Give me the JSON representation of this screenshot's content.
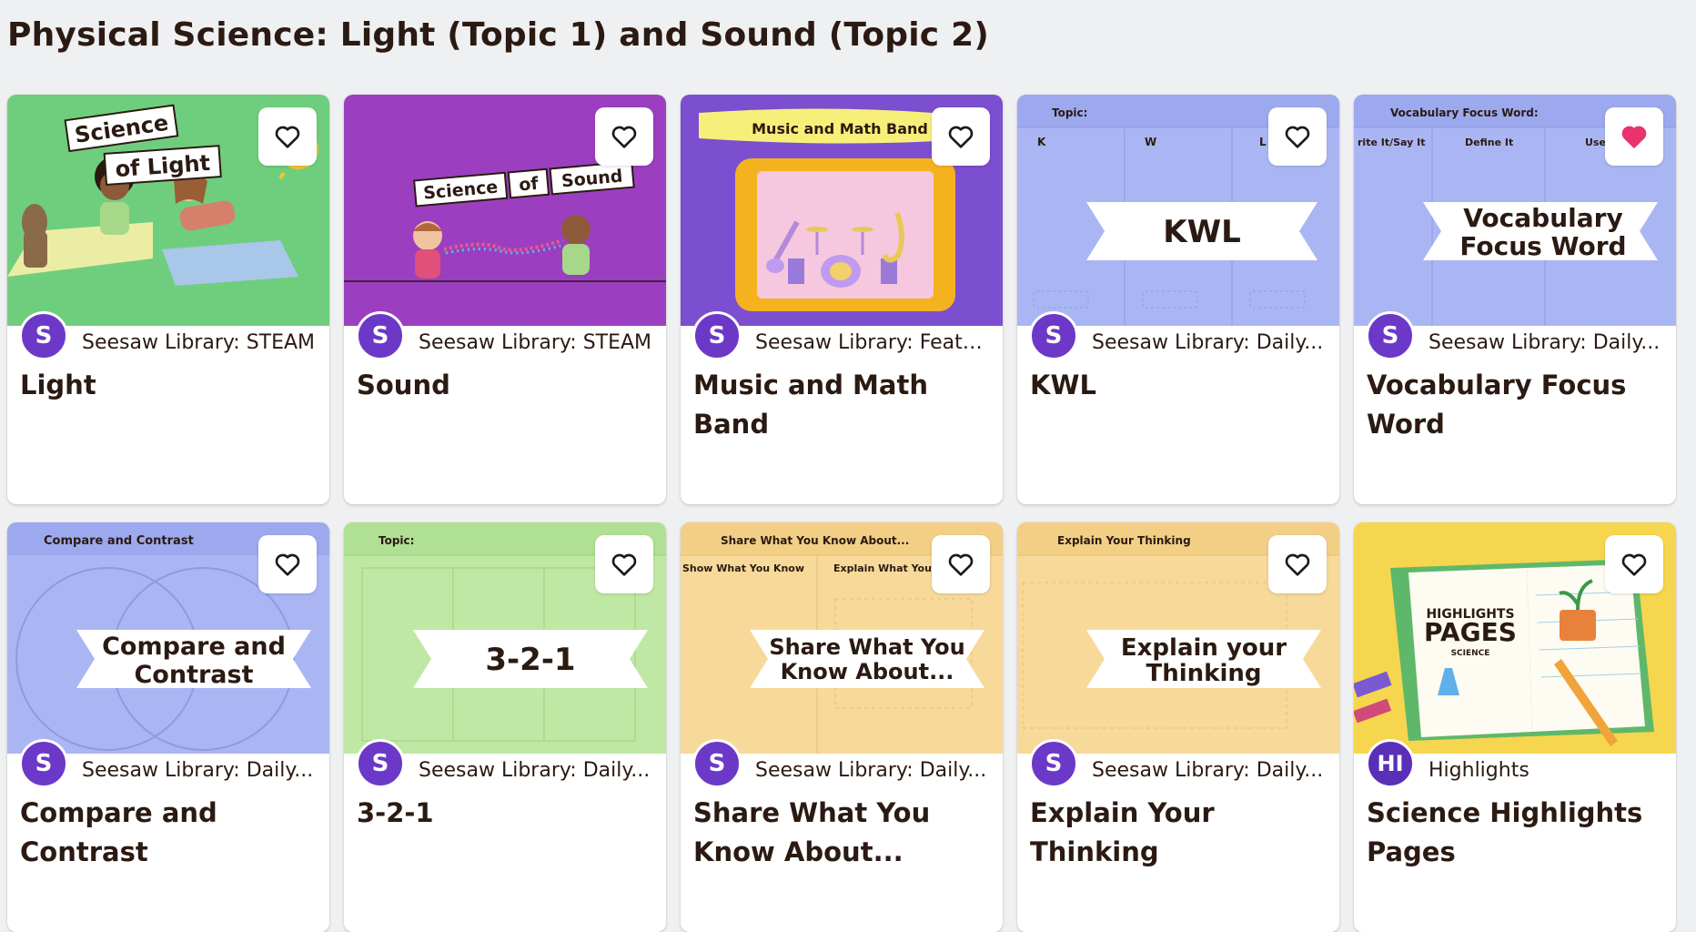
{
  "page_title": "Physical Science: Light (Topic 1) and Sound (Topic 2)",
  "colors": {
    "accent_purple": "#6c38c8",
    "favorite_active": "#e8336d",
    "text": "#2b1a12",
    "page_bg": "#eff0f2"
  },
  "cards": [
    {
      "title": "Light",
      "source": "Seesaw Library: STEAM",
      "avatar": "S",
      "favorited": false,
      "thumb": {
        "text_1": "Science",
        "text_2": "of Light"
      }
    },
    {
      "title": "Sound",
      "source": "Seesaw Library: STEAM",
      "avatar": "S",
      "favorited": false,
      "thumb": {
        "text_1": "Science",
        "text_2": "of",
        "text_3": "Sound"
      }
    },
    {
      "title": "Music and Math Band",
      "source": "Seesaw Library: Feature...",
      "avatar": "S",
      "favorited": false,
      "thumb": {
        "text_1": "Music and Math Band"
      }
    },
    {
      "title": "KWL",
      "source": "Seesaw Library: Daily...",
      "avatar": "S",
      "favorited": false,
      "thumb": {
        "header": "Topic:",
        "text_1": "KWL",
        "cols": [
          "K",
          "W",
          "L"
        ]
      }
    },
    {
      "title": "Vocabulary Focus Word",
      "source": "Seesaw Library: Daily...",
      "avatar": "S",
      "favorited": true,
      "thumb": {
        "header": "Vocabulary Focus Word:",
        "text_1": "Vocabulary",
        "text_2": "Focus Word",
        "cols": [
          "rite It/Say It",
          "Define It",
          "Use"
        ]
      }
    },
    {
      "title": "Compare and Contrast",
      "source": "Seesaw Library: Daily...",
      "avatar": "S",
      "favorited": false,
      "thumb": {
        "header": "Compare and Contrast",
        "text_1": "Compare and",
        "text_2": "Contrast"
      }
    },
    {
      "title": "3-2-1",
      "source": "Seesaw Library: Daily...",
      "avatar": "S",
      "favorited": false,
      "thumb": {
        "header": "Topic:",
        "text_1": "3-2-1"
      }
    },
    {
      "title": "Share What You Know About...",
      "source": "Seesaw Library: Daily...",
      "avatar": "S",
      "favorited": false,
      "thumb": {
        "header": "Share What You Know About...",
        "text_1": "Share What You",
        "text_2": "Know About...",
        "cols": [
          "Show What You Know",
          "Explain What You K"
        ]
      }
    },
    {
      "title": "Explain Your Thinking",
      "source": "Seesaw Library: Daily...",
      "avatar": "S",
      "favorited": false,
      "thumb": {
        "header": "Explain Your Thinking",
        "text_1": "Explain your",
        "text_2": "Thinking"
      }
    },
    {
      "title": "Science Highlights Pages",
      "source": "Highlights",
      "avatar": "HI",
      "favorited": false,
      "thumb": {
        "text_1": "HIGHLIGHTS",
        "text_2": "PAGES",
        "text_3": "SCIENCE"
      }
    }
  ]
}
